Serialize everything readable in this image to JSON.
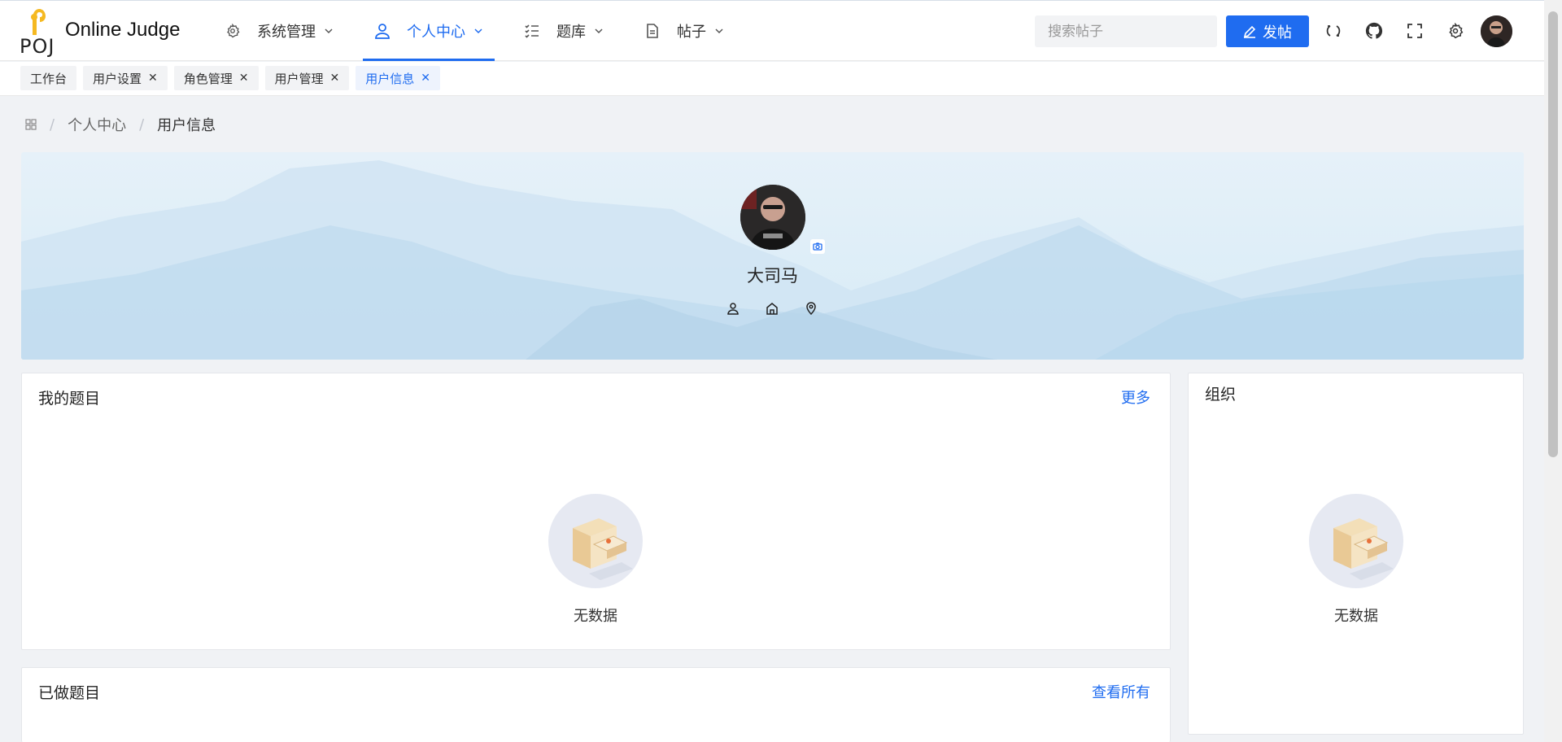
{
  "brand": {
    "logo_text": "POJ",
    "title": "Online Judge"
  },
  "nav": [
    {
      "label": "系统管理",
      "icon": "gear-icon"
    },
    {
      "label": "个人中心",
      "icon": "user-icon",
      "active": true
    },
    {
      "label": "题库",
      "icon": "list-check-icon"
    },
    {
      "label": "帖子",
      "icon": "document-icon"
    }
  ],
  "search": {
    "placeholder": "搜索帖子"
  },
  "post_button": {
    "label": "发帖"
  },
  "tags": [
    {
      "label": "工作台",
      "closable": false
    },
    {
      "label": "用户设置",
      "closable": true
    },
    {
      "label": "角色管理",
      "closable": true
    },
    {
      "label": "用户管理",
      "closable": true
    },
    {
      "label": "用户信息",
      "closable": true,
      "active": true
    }
  ],
  "breadcrumb": {
    "level1": "个人中心",
    "level2": "用户信息"
  },
  "profile": {
    "username": "大司马"
  },
  "my_problems": {
    "title": "我的题目",
    "link": "更多",
    "empty": "无数据"
  },
  "organization": {
    "title": "组织",
    "empty": "无数据"
  },
  "done_problems": {
    "title": "已做题目",
    "link": "查看所有"
  },
  "colors": {
    "accent": "#1f6cf0",
    "page_bg": "#f0f2f5",
    "brand_yellow": "#f5b921"
  }
}
